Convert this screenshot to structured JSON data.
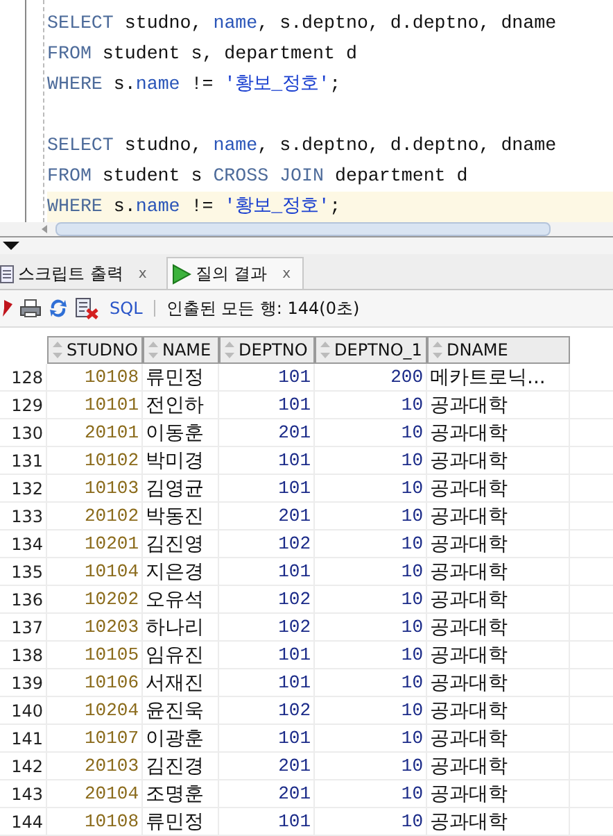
{
  "editor": {
    "lines": [
      {
        "highlighted": false,
        "tokens": [
          {
            "text": "SELECT",
            "kind": "keyword"
          },
          {
            "text": " studno, ",
            "kind": "plain"
          },
          {
            "text": "name",
            "kind": "ident"
          },
          {
            "text": ", s.deptno, d.deptno, dname",
            "kind": "plain"
          }
        ]
      },
      {
        "highlighted": false,
        "tokens": [
          {
            "text": "FROM",
            "kind": "keyword"
          },
          {
            "text": " student s, department d",
            "kind": "plain"
          }
        ]
      },
      {
        "highlighted": false,
        "tokens": [
          {
            "text": "WHERE",
            "kind": "keyword"
          },
          {
            "text": " s.",
            "kind": "plain"
          },
          {
            "text": "name",
            "kind": "ident"
          },
          {
            "text": " != ",
            "kind": "plain"
          },
          {
            "text": "'황보_정호'",
            "kind": "string"
          },
          {
            "text": ";",
            "kind": "plain"
          }
        ]
      },
      {
        "highlighted": false
      },
      {
        "highlighted": false,
        "tokens": [
          {
            "text": "SELECT",
            "kind": "keyword"
          },
          {
            "text": " studno, ",
            "kind": "plain"
          },
          {
            "text": "name",
            "kind": "ident"
          },
          {
            "text": ", s.deptno, d.deptno, dname",
            "kind": "plain"
          }
        ]
      },
      {
        "highlighted": false,
        "tokens": [
          {
            "text": "FROM",
            "kind": "keyword"
          },
          {
            "text": " student s ",
            "kind": "plain"
          },
          {
            "text": "CROSS JOIN",
            "kind": "keyword"
          },
          {
            "text": " department d",
            "kind": "plain"
          }
        ]
      },
      {
        "highlighted": true,
        "tokens": [
          {
            "text": "WHERE",
            "kind": "keyword"
          },
          {
            "text": " s.",
            "kind": "plain"
          },
          {
            "text": "name",
            "kind": "ident"
          },
          {
            "text": " != ",
            "kind": "plain"
          },
          {
            "text": "'황보_정호'",
            "kind": "string"
          },
          {
            "text": ";",
            "kind": "plain"
          }
        ]
      }
    ]
  },
  "tabs": [
    {
      "label": "스크립트 출력",
      "close": "x",
      "kind": "script",
      "selected": false
    },
    {
      "label": "질의 결과",
      "close": "x",
      "kind": "query",
      "selected": true
    }
  ],
  "toolbar": {
    "sql_link": "SQL",
    "status": "인출된 모든 행: 144(0초)"
  },
  "table": {
    "columns": [
      "",
      "STUDNO",
      "NAME",
      "DEPTNO",
      "DEPTNO_1",
      "DNAME"
    ],
    "rows": [
      [
        "128",
        "10108",
        "류민정",
        "101",
        "200",
        "메카트로닉..."
      ],
      [
        "129",
        "10101",
        "전인하",
        "101",
        "10",
        "공과대학"
      ],
      [
        "130",
        "20101",
        "이동훈",
        "201",
        "10",
        "공과대학"
      ],
      [
        "131",
        "10102",
        "박미경",
        "101",
        "10",
        "공과대학"
      ],
      [
        "132",
        "10103",
        "김영균",
        "101",
        "10",
        "공과대학"
      ],
      [
        "133",
        "20102",
        "박동진",
        "201",
        "10",
        "공과대학"
      ],
      [
        "134",
        "10201",
        "김진영",
        "102",
        "10",
        "공과대학"
      ],
      [
        "135",
        "10104",
        "지은경",
        "101",
        "10",
        "공과대학"
      ],
      [
        "136",
        "10202",
        "오유석",
        "102",
        "10",
        "공과대학"
      ],
      [
        "137",
        "10203",
        "하나리",
        "102",
        "10",
        "공과대학"
      ],
      [
        "138",
        "10105",
        "임유진",
        "101",
        "10",
        "공과대학"
      ],
      [
        "139",
        "10106",
        "서재진",
        "101",
        "10",
        "공과대학"
      ],
      [
        "140",
        "10204",
        "윤진욱",
        "102",
        "10",
        "공과대학"
      ],
      [
        "141",
        "10107",
        "이광훈",
        "101",
        "10",
        "공과대학"
      ],
      [
        "142",
        "20103",
        "김진경",
        "201",
        "10",
        "공과대학"
      ],
      [
        "143",
        "20104",
        "조명훈",
        "201",
        "10",
        "공과대학"
      ],
      [
        "144",
        "10108",
        "류민정",
        "101",
        "10",
        "공과대학"
      ]
    ]
  }
}
